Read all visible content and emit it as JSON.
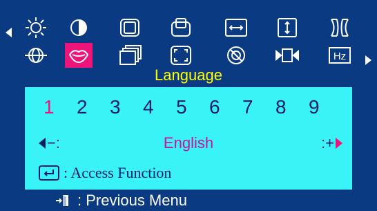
{
  "icons": [
    {
      "name": "brightness-icon",
      "selected": false
    },
    {
      "name": "contrast-icon",
      "selected": false
    },
    {
      "name": "image-size-icon",
      "selected": false
    },
    {
      "name": "image-position-icon",
      "selected": false
    },
    {
      "name": "horizontal-size-icon",
      "selected": false
    },
    {
      "name": "vertical-size-icon",
      "selected": false
    },
    {
      "name": "pincushion-icon",
      "selected": false
    },
    {
      "name": "rotation-icon",
      "selected": false
    },
    {
      "name": "language-icon",
      "selected": true
    },
    {
      "name": "multi-window-icon",
      "selected": false
    },
    {
      "name": "zoom-icon",
      "selected": false
    },
    {
      "name": "degauss-icon",
      "selected": false
    },
    {
      "name": "moire-icon",
      "selected": false
    },
    {
      "name": "frequency-icon",
      "selected": false
    }
  ],
  "section_title": "Language",
  "digits": [
    "1",
    "2",
    "3",
    "4",
    "5",
    "6",
    "7",
    "8",
    "9"
  ],
  "active_digit": "1",
  "minus_label": "−:",
  "current_language": "English",
  "plus_label": ":+",
  "access_text": ": Access Function",
  "previous_menu_text": ":  Previous Menu",
  "colors": {
    "background": "#0a3b82",
    "panel": "#39f3f7",
    "highlight": "#f0147a",
    "title": "#ffff00",
    "dark_text": "#0a1d6a"
  }
}
